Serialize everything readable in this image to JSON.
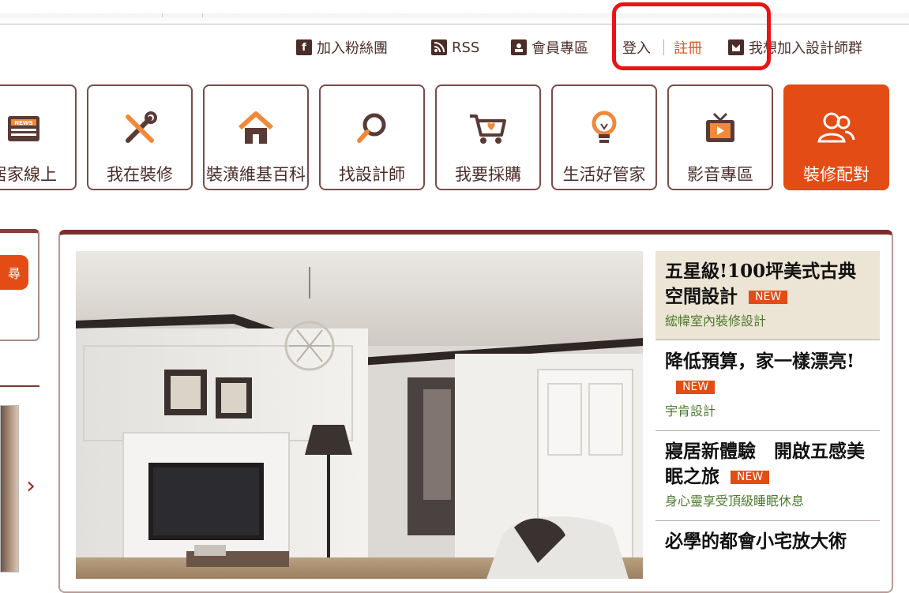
{
  "header": {
    "links": [
      {
        "icon": "facebook-icon",
        "label": "加入粉絲團"
      },
      {
        "icon": "rss-icon",
        "label": "RSS"
      },
      {
        "icon": "member-icon",
        "label": "會員專區"
      },
      {
        "label": "登入"
      },
      {
        "label": "註冊"
      },
      {
        "icon": "designer-icon",
        "label": "我想加入設計師群"
      }
    ]
  },
  "nav": {
    "tiles": [
      {
        "label": "居家線上",
        "icon": "newspaper-icon"
      },
      {
        "label": "我在裝修",
        "icon": "tools-icon"
      },
      {
        "label": "裝潢維基百科",
        "icon": "house-icon"
      },
      {
        "label": "找設計師",
        "icon": "magnifier-icon"
      },
      {
        "label": "我要採購",
        "icon": "shopping-cart-icon"
      },
      {
        "label": "生活好管家",
        "icon": "lightbulb-icon"
      },
      {
        "label": "影音專區",
        "icon": "tv-icon"
      },
      {
        "label": "裝修配對",
        "icon": "people-icon"
      }
    ]
  },
  "left": {
    "button_label": "尋"
  },
  "articles": [
    {
      "title": "五星級!100坪美式古典空間設計",
      "badge": "NEW",
      "source": "綋幃室內裝修設計"
    },
    {
      "title": "降低預算，家一樣漂亮!",
      "badge": "NEW",
      "source": "宇肯設計"
    },
    {
      "title": "寢居新體驗　開啟五感美眠之旅",
      "badge": "NEW",
      "source": "身心靈享受頂級睡眠休息"
    },
    {
      "title": "必學的都會小宅放大術",
      "badge": "",
      "source": ""
    }
  ],
  "colors": {
    "accent": "#e34c14",
    "brand_dark": "#4a2c28",
    "frame": "#7b2e2b",
    "highlight": "#ea1414"
  }
}
